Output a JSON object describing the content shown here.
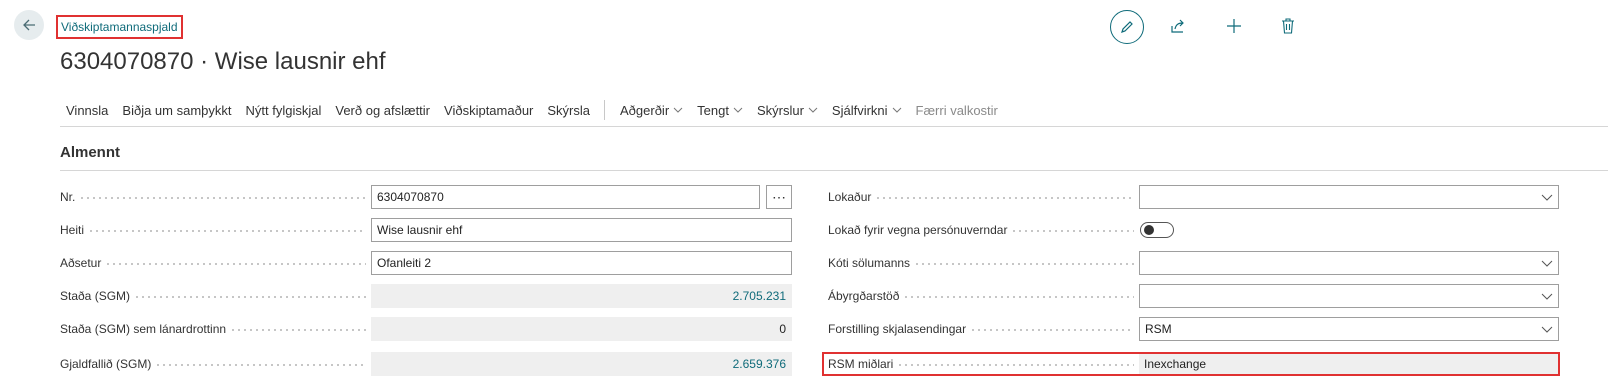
{
  "header": {
    "entity_type": "Viðskiptamannaspjald",
    "title": "6304070870 · Wise lausnir ehf"
  },
  "actions": {
    "items": [
      {
        "label": "Vinnsla"
      },
      {
        "label": "Biðja um samþykkt"
      },
      {
        "label": "Nýtt fylgiskjal"
      },
      {
        "label": "Verð og afslættir"
      },
      {
        "label": "Viðskiptamaður"
      },
      {
        "label": "Skýrsla"
      }
    ],
    "menus": [
      {
        "label": "Aðgerðir"
      },
      {
        "label": "Tengt"
      },
      {
        "label": "Skýrslur"
      },
      {
        "label": "Sjálfvirkni"
      }
    ],
    "fewer_options": "Færri valkostir"
  },
  "section": {
    "title": "Almennt"
  },
  "left_fields": {
    "nr": {
      "label": "Nr.",
      "value": "6304070870"
    },
    "heiti": {
      "label": "Heiti",
      "value": "Wise lausnir ehf"
    },
    "adsetur": {
      "label": "Aðsetur",
      "value": "Ofanleiti 2"
    },
    "stada": {
      "label": "Staða (SGM)",
      "value": "2.705.231"
    },
    "stada_lanardrottinn": {
      "label": "Staða (SGM) sem lánardrottinn",
      "value": "0"
    },
    "gjaldfallid": {
      "label": "Gjaldfallið (SGM)",
      "value": "2.659.376"
    }
  },
  "right_fields": {
    "lokadur": {
      "label": "Lokaður",
      "value": ""
    },
    "lokad_personuvernd": {
      "label": "Lokað fyrir vegna persónuverndar"
    },
    "koti_solumanns": {
      "label": "Kóti sölumanns",
      "value": ""
    },
    "abyrgdarstod": {
      "label": "Ábyrgðarstöð",
      "value": ""
    },
    "forstilling": {
      "label": "Forstilling skjalasendingar",
      "value": "RSM"
    },
    "rsm_midlari": {
      "label": "RSM miðlari",
      "value": "Inexchange"
    }
  },
  "colors": {
    "accent": "#0f6b7a",
    "highlight": "#e03131"
  }
}
